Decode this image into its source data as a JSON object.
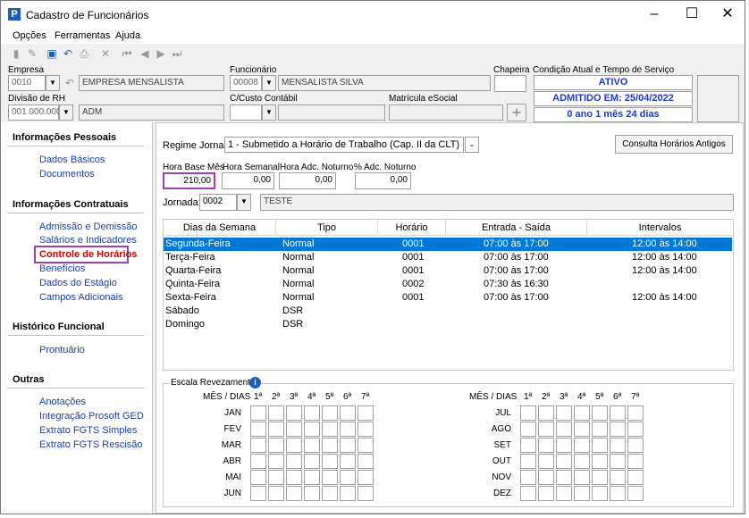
{
  "window": {
    "title": "Cadastro de Funcionários"
  },
  "menu": [
    "Opções",
    "Ferramentas",
    "Ajuda"
  ],
  "header": {
    "empresa_label": "Empresa",
    "empresa_code": "0010",
    "empresa_name": "EMPRESA MENSALISTA",
    "funcionario_label": "Funcionário",
    "funcionario_code": "00008",
    "funcionario_name": "MENSALISTA SILVA",
    "chapeira_label": "Chapeira",
    "divisao_label": "Divisão de RH",
    "divisao_code": "001.000.000",
    "divisao_name": "ADM",
    "ccusto_label": "C/Custo Contábil",
    "matricula_label": "Matrícula eSocial",
    "condicao_label": "Condição Atual e Tempo de Serviço",
    "status_ativo": "ATIVO",
    "status_admitido": "ADMITIDO EM: 25/04/2022",
    "status_tempo": "0 ano 1 mês 24 dias"
  },
  "sidebar": {
    "sections": [
      {
        "title": "Informações Pessoais",
        "items": [
          "Dados Básicos",
          "Documentos"
        ]
      },
      {
        "title": "Informações Contratuais",
        "items": [
          "Admissão e Demissão",
          "Salários e Indicadores",
          "Controle de Horários",
          "Benefícios",
          "Dados do Estágio",
          "Campos Adicionais"
        ]
      },
      {
        "title": "Histórico Funcional",
        "items": [
          "Prontuário"
        ]
      },
      {
        "title": "Outras",
        "items": [
          "Anotações",
          "Integração Prosoft GED",
          "Extrato FGTS Simples",
          "Extrato FGTS Rescisão"
        ]
      }
    ]
  },
  "main": {
    "regime_label": "Regime Jornada",
    "regime_value": "1 - Submetido a Horário de Trabalho (Cap. II da CLT)",
    "consulta_button": "Consulta Horários Antigos",
    "hora_base_label": "Hora Base Mês",
    "hora_base_value": "210,00",
    "hora_semanal_label": "Hora Semanal",
    "hora_semanal_value": "0,00",
    "hora_adc_label": "Hora Adc. Noturno",
    "hora_adc_value": "0,00",
    "perc_adc_label": "% Adc. Noturno",
    "perc_adc_value": "0,00",
    "jornada_label": "Jornada:",
    "jornada_code": "0002",
    "jornada_name": "TESTE",
    "table_headers": [
      "Dias da Semana",
      "Tipo",
      "Horário",
      "Entrada - Saída",
      "Intervalos"
    ],
    "rows": [
      {
        "dia": "Segunda-Feira",
        "tipo": "Normal",
        "horario": "0001",
        "entrada": "07:00 às 17:00",
        "intervalo": "12:00 às 14:00"
      },
      {
        "dia": "Terça-Feira",
        "tipo": "Normal",
        "horario": "0001",
        "entrada": "07:00 às 17:00",
        "intervalo": "12:00 às 14:00"
      },
      {
        "dia": "Quarta-Feira",
        "tipo": "Normal",
        "horario": "0001",
        "entrada": "07:00 às 17:00",
        "intervalo": "12:00 às 14:00"
      },
      {
        "dia": "Quinta-Feira",
        "tipo": "Normal",
        "horario": "0002",
        "entrada": "07:30 às 16:30",
        "intervalo": ""
      },
      {
        "dia": "Sexta-Feira",
        "tipo": "Normal",
        "horario": "0001",
        "entrada": "07:00 às 17:00",
        "intervalo": "12:00 às 14:00"
      },
      {
        "dia": "Sábado",
        "tipo": "DSR",
        "horario": "",
        "entrada": "",
        "intervalo": ""
      },
      {
        "dia": "Domingo",
        "tipo": "DSR",
        "horario": "",
        "entrada": "",
        "intervalo": ""
      }
    ],
    "escala_label": "Escala Revezamento",
    "mes_dias_label": "MÊS / DIAS",
    "day_headers": [
      "1ª",
      "2ª",
      "3ª",
      "4ª",
      "5ª",
      "6ª",
      "7ª"
    ],
    "months_left": [
      "JAN",
      "FEV",
      "MAR",
      "ABR",
      "MAI",
      "JUN"
    ],
    "months_right": [
      "JUL",
      "AGO",
      "SET",
      "OUT",
      "NOV",
      "DEZ"
    ]
  },
  "colors": {
    "selection": "#0078d7",
    "link": "#1a3fb0",
    "active_link": "#d00000",
    "status_text": "#1e3cc8",
    "highlight_border": "#9b3fb5"
  }
}
